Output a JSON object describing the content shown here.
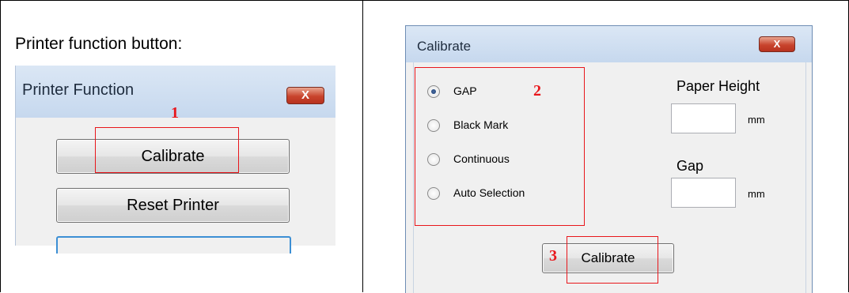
{
  "caption": "Printer function button:",
  "left_dialog": {
    "title": "Printer Function",
    "close_label": "X",
    "buttons": {
      "calibrate": "Calibrate",
      "reset": "Reset Printer"
    },
    "marker": "1"
  },
  "right_dialog": {
    "title": "Calibrate",
    "close_label": "X",
    "radios": [
      {
        "label": "GAP",
        "selected": true
      },
      {
        "label": "Black Mark",
        "selected": false
      },
      {
        "label": "Continuous",
        "selected": false
      },
      {
        "label": "Auto Selection",
        "selected": false
      }
    ],
    "paper_height": {
      "label": "Paper Height",
      "value": "",
      "unit": "mm"
    },
    "gap": {
      "label": "Gap",
      "value": "",
      "unit": "mm"
    },
    "calibrate_button": "Calibrate",
    "marker_radios": "2",
    "marker_button": "3"
  },
  "colors": {
    "annotation_red": "#e8161b",
    "titlebar": "#c6d8ee",
    "dialog_bg": "#f0f0f0"
  }
}
